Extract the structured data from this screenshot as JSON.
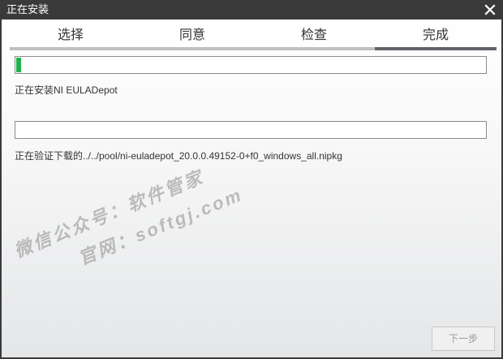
{
  "window": {
    "title": "正在安装"
  },
  "steps": [
    {
      "label": "选择",
      "active": false
    },
    {
      "label": "同意",
      "active": false
    },
    {
      "label": "检查",
      "active": false
    },
    {
      "label": "完成",
      "active": true
    }
  ],
  "install_progress": {
    "value_percent": 1,
    "status": "正在安装NI EULADepot"
  },
  "verify_progress": {
    "value_percent": 0,
    "status": "正在验证下载的../../pool/ni-euladepot_20.0.0.49152-0+f0_windows_all.nipkg"
  },
  "watermark": {
    "line1": "微信公众号：软件管家",
    "line2": "官网：softgj.com"
  },
  "footer": {
    "next_label": "下一步"
  },
  "colors": {
    "titlebar": "#3a3a3a",
    "progress_fill": "#22b24c",
    "active_step_bar": "#606468",
    "inactive_step_bar": "#c0c0c0"
  }
}
